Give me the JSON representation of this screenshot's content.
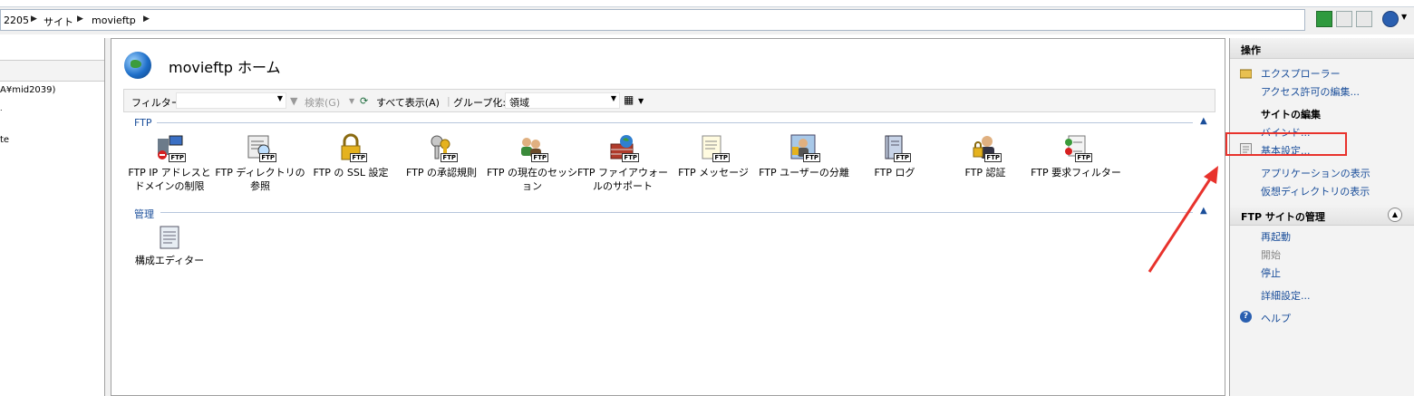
{
  "address_bar": {
    "crumbs": [
      "2205",
      "サイト",
      "movieftp"
    ]
  },
  "left_pane": {
    "items": [
      "A¥mid2039)",
      "te"
    ]
  },
  "center": {
    "title": "movieftp ホーム",
    "toolbar": {
      "filter_label": "フィルター:",
      "filter_value": "",
      "search_label": "検索(G)",
      "show_all_label": "すべて表示(A)",
      "group_by_label": "グループ化:",
      "group_by_value": "領域"
    },
    "groups": [
      {
        "name": "FTP",
        "features": [
          {
            "label": "FTP IP アドレスとドメインの制限",
            "icon": "ftp-ip-restrictions-icon"
          },
          {
            "label": "FTP ディレクトリの参照",
            "icon": "ftp-directory-browsing-icon"
          },
          {
            "label": "FTP の SSL 設定",
            "icon": "ftp-ssl-lock-icon"
          },
          {
            "label": "FTP の承認規則",
            "icon": "ftp-authorization-key-icon"
          },
          {
            "label": "FTP の現在のセッション",
            "icon": "ftp-sessions-users-icon"
          },
          {
            "label": "FTP ファイアウォールのサポート",
            "icon": "ftp-firewall-icon"
          },
          {
            "label": "FTP メッセージ",
            "icon": "ftp-messages-icon"
          },
          {
            "label": "FTP ユーザーの分離",
            "icon": "ftp-user-isolation-icon"
          },
          {
            "label": "FTP ログ",
            "icon": "ftp-logging-icon"
          },
          {
            "label": "FTP 認証",
            "icon": "ftp-authentication-icon"
          },
          {
            "label": "FTP 要求フィルター",
            "icon": "ftp-request-filtering-icon"
          }
        ]
      },
      {
        "name": "管理",
        "features": [
          {
            "label": "構成エディター",
            "icon": "configuration-editor-icon"
          }
        ]
      }
    ]
  },
  "right_pane": {
    "section1_title": "操作",
    "explore": "エクスプローラー",
    "edit_permissions": "アクセス許可の編集...",
    "site_edit_header": "サイトの編集",
    "bindings": "バインド...",
    "basic_settings": "基本設定...",
    "view_applications": "アプリケーションの表示",
    "view_virtual_dirs": "仮想ディレクトリの表示",
    "section2_title": "FTP サイトの管理",
    "restart": "再起動",
    "start": "開始",
    "stop": "停止",
    "advanced_settings": "詳細設定...",
    "help": "ヘルプ"
  },
  "colors": {
    "link": "#1a4e9a",
    "disabled": "#8a8a8a",
    "highlight_box": "#e8322c",
    "arrow": "#e8322c"
  }
}
